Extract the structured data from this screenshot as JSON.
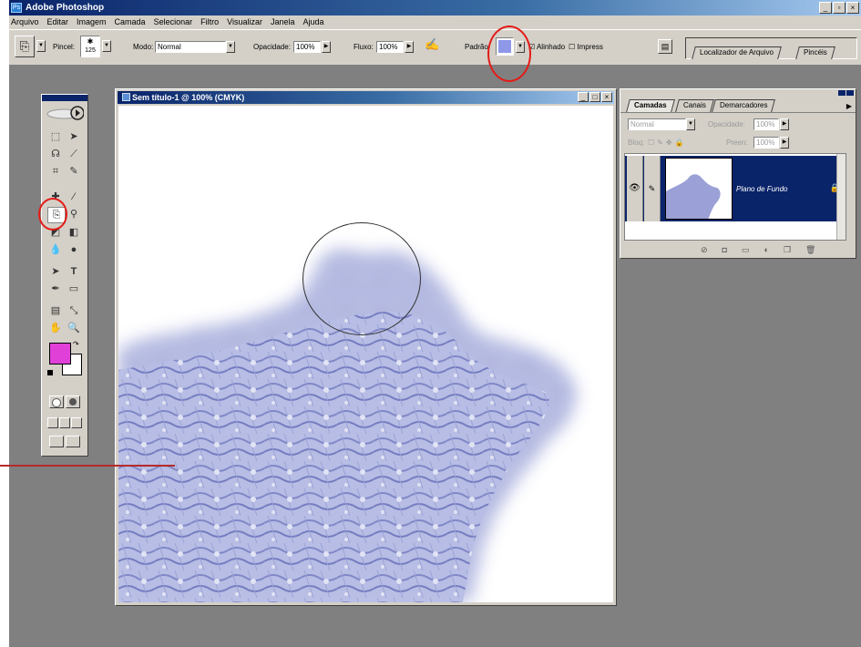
{
  "app": {
    "title": "Adobe Photoshop"
  },
  "menu": [
    "Arquivo",
    "Editar",
    "Imagem",
    "Camada",
    "Selecionar",
    "Filtro",
    "Visualizar",
    "Janela",
    "Ajuda"
  ],
  "options": {
    "pincel_label": "Pincel:",
    "brush_size": "125",
    "modo_label": "Modo:",
    "modo_value": "Normal",
    "opacidade_label": "Opacidade:",
    "opacidade_value": "100%",
    "fluxo_label": "Fluxo:",
    "fluxo_value": "100%",
    "padrao_label": "Padrão:",
    "alinhado_label": "Alinhado",
    "impress_label": "Impress",
    "well_tabs": [
      "Localizador de Arquivo",
      "Pincéis"
    ]
  },
  "document": {
    "title": "Sem título-1 @ 100% (CMYK)"
  },
  "layers_panel": {
    "tabs": [
      "Camadas",
      "Canais",
      "Demarcadores"
    ],
    "blend_mode": "Normal",
    "opacidade_label": "Opacidade:",
    "opacidade_value": "100%",
    "bloq_label": "Bloq:",
    "preen_label": "Preen:",
    "preen_value": "100%",
    "layer_name": "Plano de Fundo"
  },
  "colors": {
    "title_blue": "#0a246a",
    "workspace_gray": "#808080",
    "foreground": "#e040d8",
    "background": "#ffffff",
    "pattern": "#8f97cf",
    "annotation_red": "#e41b17",
    "selected_layer": "#0a246a"
  },
  "icons": {
    "pattern_stamp_tool": "pattern-stamp-icon",
    "marquee": "marquee-icon",
    "move": "move-icon",
    "lasso": "lasso-icon",
    "magic_wand": "magic-wand-icon",
    "crop": "crop-icon",
    "brush": "brush-icon",
    "eye": "eye-icon",
    "lock": "lock-icon"
  }
}
